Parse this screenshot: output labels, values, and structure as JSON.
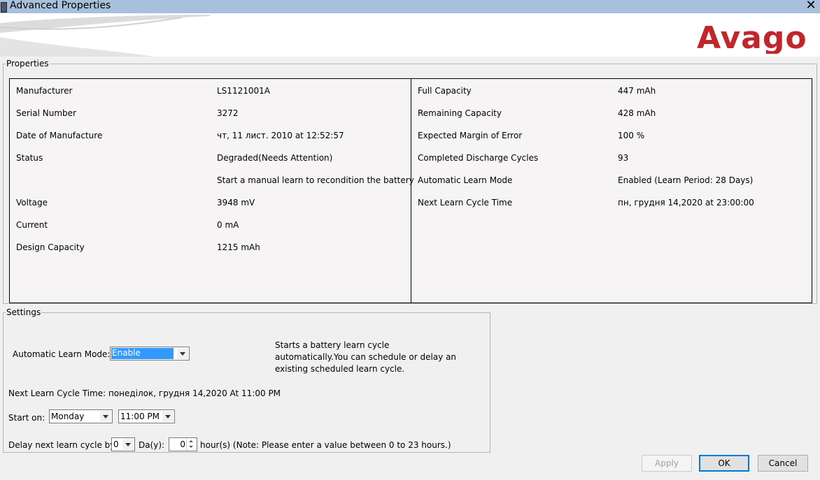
{
  "window": {
    "title": "Advanced Properties",
    "close_glyph": "✕"
  },
  "brand": {
    "logo_text": "Avago",
    "logo_color": "#c1262d"
  },
  "properties": {
    "legend": "Properties",
    "left": [
      {
        "key": "Manufacturer",
        "value": "LS1121001A"
      },
      {
        "key": "Serial Number",
        "value": "3272"
      },
      {
        "key": "Date of Manufacture",
        "value": "чт, 11 лист. 2010 at 12:52:57"
      },
      {
        "key": "Status",
        "value": "Degraded(Needs Attention)"
      },
      {
        "key": "",
        "value": "Start a manual learn to recondition the battery"
      },
      {
        "key": "Voltage",
        "value": "3948 mV"
      },
      {
        "key": "Current",
        "value": "0 mA"
      },
      {
        "key": "Design Capacity",
        "value": "1215 mAh"
      }
    ],
    "right": [
      {
        "key": "Full Capacity",
        "value": "447 mAh"
      },
      {
        "key": "Remaining Capacity",
        "value": "428 mAh"
      },
      {
        "key": "Expected Margin of Error",
        "value": "100 %"
      },
      {
        "key": "Completed Discharge Cycles",
        "value": "93"
      },
      {
        "key": "Automatic Learn Mode",
        "value": "Enabled (Learn Period: 28 Days)"
      },
      {
        "key": "Next Learn Cycle Time",
        "value": "пн, грудня 14,2020 at 23:00:00"
      }
    ]
  },
  "settings": {
    "legend": "Settings",
    "auto_learn_label": "Automatic Learn Mode:",
    "auto_learn_value": "Enable",
    "description": "Starts a battery learn cycle automatically.You can schedule or delay an existing scheduled learn cycle.",
    "next_learn_label": "Next Learn Cycle Time: понеділок, грудня 14,2020 At 11:00 PM",
    "start_on_label": "Start on:",
    "start_day": "Monday",
    "start_time": "11:00 PM",
    "delay_label": "Delay next learn cycle by",
    "delay_days_value": "0",
    "days_label": "Da(y):",
    "delay_hours_value": "0",
    "hours_note": "hour(s) (Note: Please enter a value between 0 to 23 hours.)"
  },
  "buttons": {
    "apply": "Apply",
    "ok": "OK",
    "cancel": "Cancel"
  }
}
